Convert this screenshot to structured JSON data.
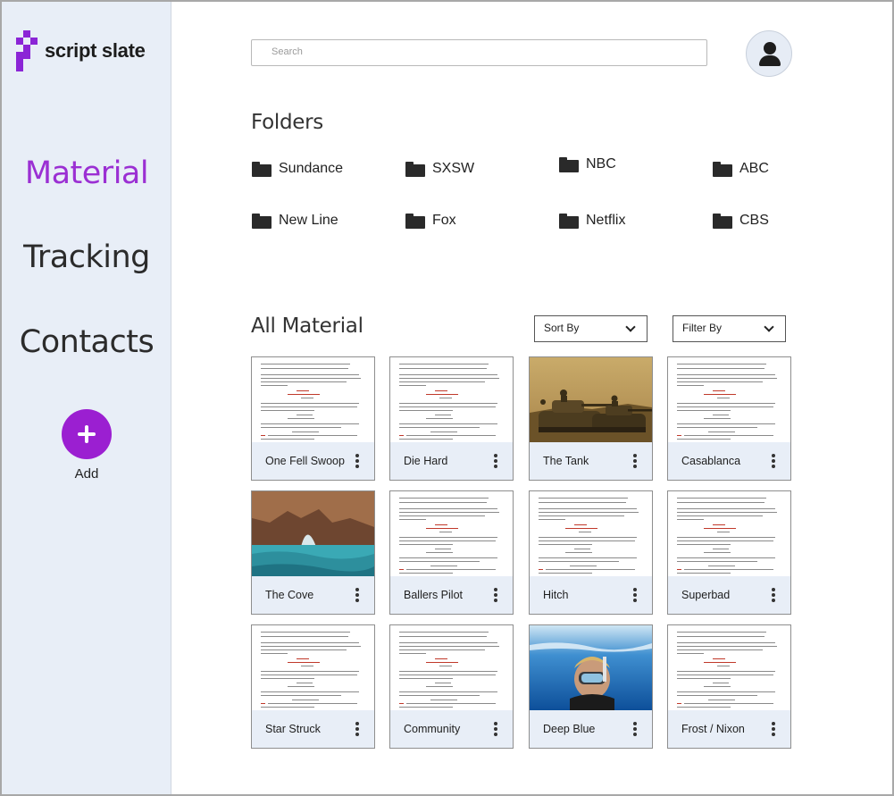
{
  "app": {
    "name": "script slate"
  },
  "sidebar": {
    "nav": [
      {
        "label": "Material",
        "active": true
      },
      {
        "label": "Tracking",
        "active": false
      },
      {
        "label": "Contacts",
        "active": false
      }
    ],
    "add_label": "Add"
  },
  "header": {
    "search_placeholder": "Search",
    "avatar_icon": "user-icon"
  },
  "folders": {
    "title": "Folders",
    "items": [
      "Sundance",
      "SXSW",
      "NBC",
      "ABC",
      "New Line",
      "Fox",
      "Netflix",
      "CBS"
    ]
  },
  "material": {
    "title": "All Material",
    "sort_label": "Sort By",
    "filter_label": "Filter By",
    "cards": [
      {
        "title": "One Fell Swoop",
        "thumb": "script"
      },
      {
        "title": "Die Hard",
        "thumb": "script"
      },
      {
        "title": "The Tank",
        "thumb": "tank-photo"
      },
      {
        "title": "Casablanca",
        "thumb": "script"
      },
      {
        "title": "The Cove",
        "thumb": "cove-photo"
      },
      {
        "title": "Ballers Pilot",
        "thumb": "script"
      },
      {
        "title": "Hitch",
        "thumb": "script"
      },
      {
        "title": "Superbad",
        "thumb": "script"
      },
      {
        "title": "Star Struck",
        "thumb": "script"
      },
      {
        "title": "Community",
        "thumb": "script"
      },
      {
        "title": "Deep Blue",
        "thumb": "diver-photo"
      },
      {
        "title": "Frost / Nixon",
        "thumb": "script"
      }
    ]
  },
  "colors": {
    "accent": "#9b2fd3",
    "sidebar_bg": "#e8eef7",
    "card_footer_bg": "#e8eef7"
  }
}
